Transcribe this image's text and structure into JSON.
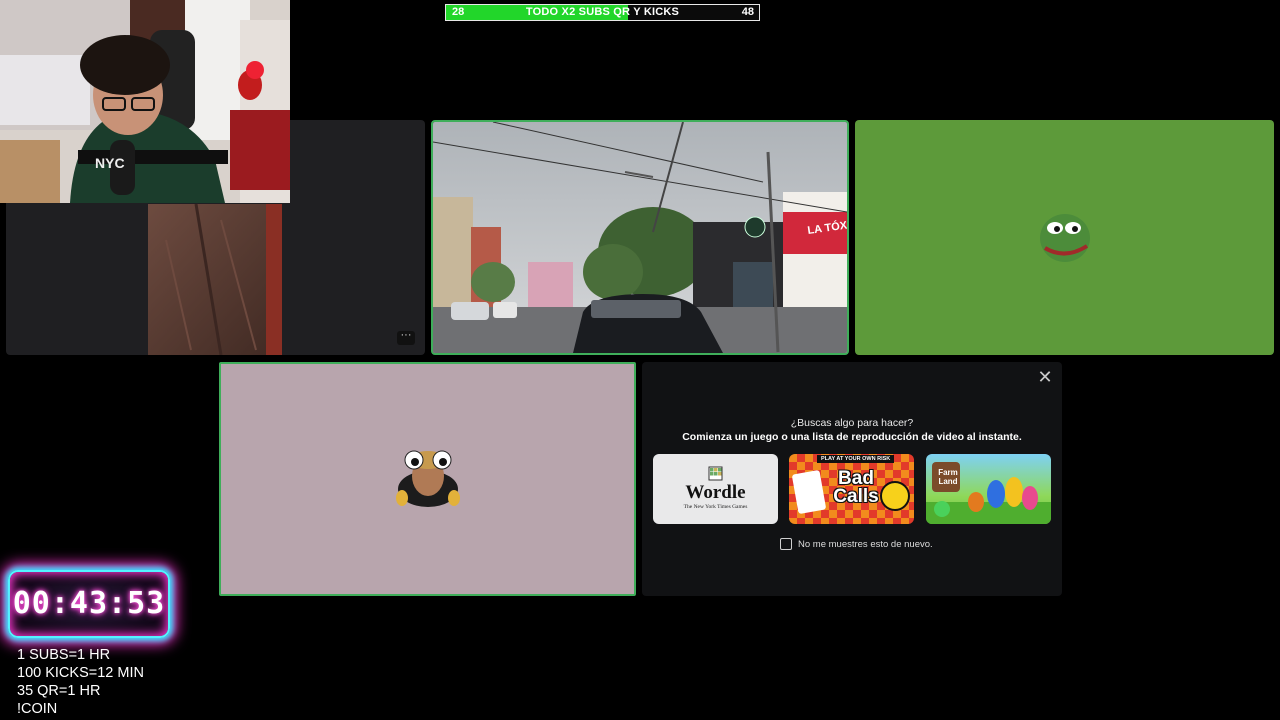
{
  "goal_bar": {
    "left_value": "28",
    "label": "TODO X2 SUBS QR Y KICKS",
    "right_value": "48",
    "progress_fraction": 0.58,
    "fill_color": "#22d62a"
  },
  "tiles": {
    "dark_tile_menu": "···",
    "green_tile_color": "#5d9a3a",
    "pink_tile_color": "#b8a5ad",
    "speaking_border_color": "#3fae5a"
  },
  "street_sign": "LA TÓXICA",
  "activity_panel": {
    "close_icon": "close-icon",
    "title": "¿Buscas algo para hacer?",
    "subtitle": "Comienza un juego o una lista de reproducción de video al instante.",
    "games": [
      {
        "name": "Wordle",
        "publisher": "The New York Times Games"
      },
      {
        "name": "Bad Calls",
        "banner": "PLAY AT YOUR OWN RISK"
      },
      {
        "name": "Farm Land"
      }
    ],
    "dont_show_label": "No me muestres esto de nuevo."
  },
  "timer": {
    "value": "00:43:53"
  },
  "rules": [
    "1 SUBS=1 HR",
    "100 KICKS=12 MIN",
    "35 QR=1 HR",
    "!COIN"
  ]
}
